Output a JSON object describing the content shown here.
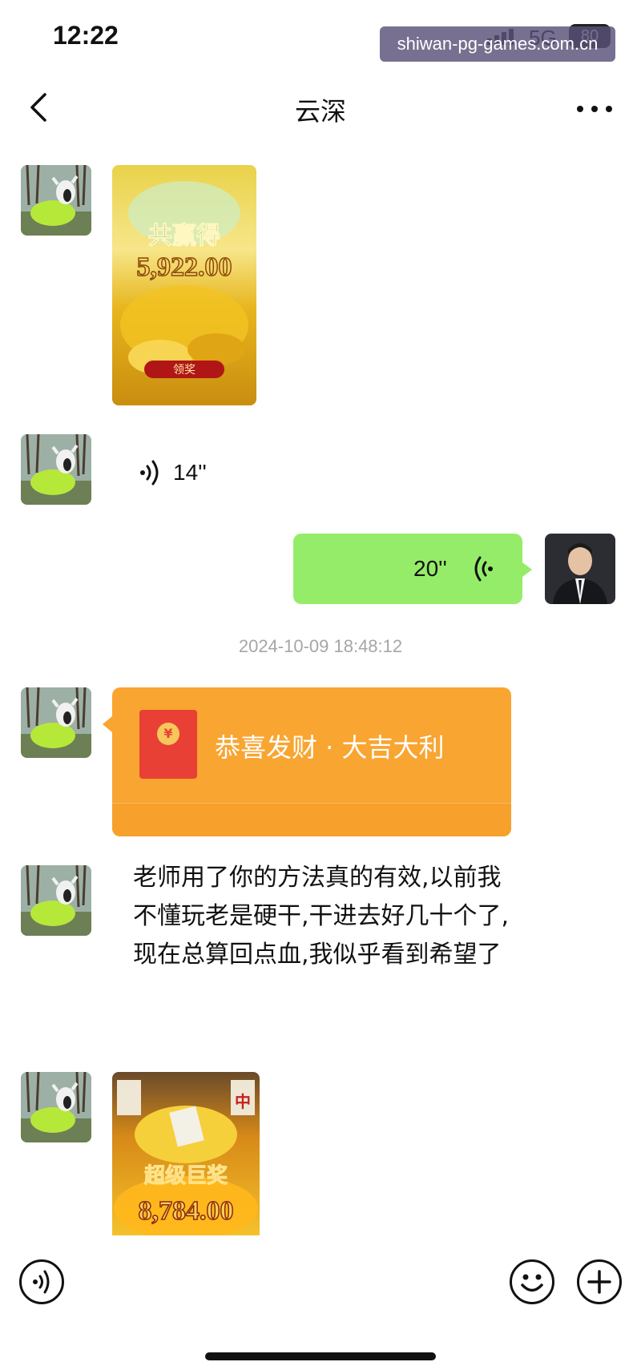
{
  "status_bar": {
    "time": "12:22",
    "network": "5G",
    "battery": "80",
    "watermark": "shiwan-pg-games.com.cn"
  },
  "header": {
    "title": "云深"
  },
  "messages": {
    "image1": {
      "title": "共赢得",
      "amount": "5,922.00",
      "button": "领奖"
    },
    "voice_in": {
      "duration": "14''"
    },
    "voice_out": {
      "duration": "20''"
    },
    "timestamp": "2024-10-09 18:48:12",
    "red_packet": {
      "text": "恭喜发财 · 大吉大利",
      "coin_symbol": "¥"
    },
    "text_msg": "老师用了你的方法真的有效,以前我不懂玩老是硬干,干进去好几十个了,现在总算回点血,我似乎看到希望了",
    "image2": {
      "tile": "中",
      "title": "超级巨奖",
      "amount": "8,784.00"
    }
  },
  "icons": {
    "back": "chevron-left-icon",
    "more": "more-dots-icon",
    "voice": "voice-wave-icon",
    "emoji": "emoji-icon",
    "add": "plus-icon"
  },
  "colors": {
    "outgoing_bubble": "#95ec69",
    "red_packet": "#f9a531",
    "red_packet_icon": "#e94036",
    "timestamp": "#a6a6a6"
  }
}
